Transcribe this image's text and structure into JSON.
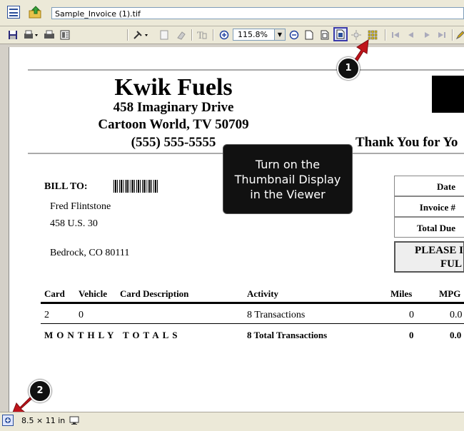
{
  "window": {
    "filename": "Sample_Invoice (1).tif"
  },
  "toolbar": {
    "zoom": "115.8%"
  },
  "invoice": {
    "company": "Kwik Fuels",
    "address1": "458 Imaginary Drive",
    "address2": "Cartoon World, TV 50709",
    "phone": "(555) 555-5555",
    "thanks": "Thank You for Yo",
    "bill_to_label": "BILL TO:",
    "customer_name": "Fred Flintstone",
    "customer_street": "458 U.S. 30",
    "customer_city": "Bedrock, CO 80111",
    "info_labels": [
      "Date",
      "Invoice #",
      "Total Due"
    ],
    "please_line1": "PLEASE I",
    "please_line2": "FUL",
    "columns": [
      "Card",
      "Vehicle",
      "Card Description",
      "Activity",
      "Miles",
      "MPG"
    ],
    "row": {
      "card": "2",
      "vehicle": "0",
      "activity": "8 Transactions",
      "miles": "0",
      "mpg": "0.0"
    },
    "totals": {
      "label": "MONTHLY TOTALS",
      "activity": "8 Total Transactions",
      "miles": "0",
      "mpg": "0.0"
    }
  },
  "callout": {
    "text_line1": "Turn on the",
    "text_line2": "Thumbnail Display",
    "text_line3": "in the Viewer"
  },
  "badges": {
    "one": "1",
    "two": "2"
  },
  "status": {
    "page_size": "8.5 × 11 in"
  },
  "colors": {
    "arrow": "#c0141b",
    "highlight_border": "#3a3aa8"
  }
}
